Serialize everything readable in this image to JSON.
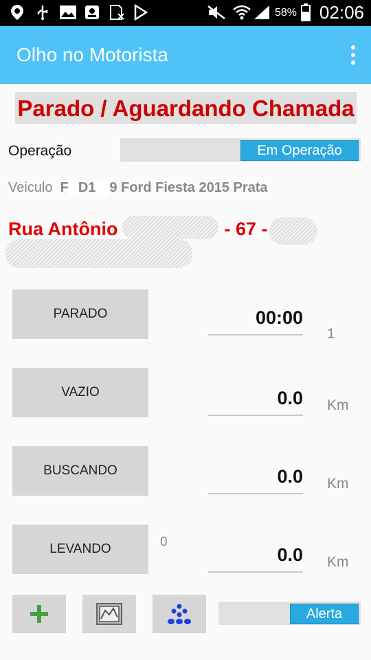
{
  "status_bar": {
    "battery": "58%",
    "time": "02:06",
    "icons": [
      "location-icon",
      "usb-icon",
      "gallery-icon",
      "notification-app-icon",
      "sim-icon",
      "play-store-icon",
      "mute-icon",
      "wifi-icon",
      "signal-icon",
      "battery-icon"
    ]
  },
  "app_bar": {
    "title": "Olho no Motorista",
    "menu_icon": "overflow-menu-icon"
  },
  "status_title": "Parado / Aguardando Chamada",
  "operation": {
    "label": "Operação",
    "toggle_text": "Em Operação"
  },
  "vehicle": {
    "label": "Veiculo",
    "plate_parts": [
      "F",
      "D1",
      "9"
    ],
    "model": "Ford Fiesta 2015 Prata"
  },
  "address": {
    "street": "Rua Antônio",
    "number": "- 67 -"
  },
  "rows": [
    {
      "button": "PARADO",
      "value": "00:00",
      "unit": "1"
    },
    {
      "button": "VAZIO",
      "value": "0.0",
      "unit": "Km"
    },
    {
      "button": "BUSCANDO",
      "value": "0.0",
      "unit": "Km"
    },
    {
      "button": "LEVANDO",
      "value": "0.0",
      "unit": "Km",
      "count": "0"
    }
  ],
  "bottom": {
    "icons": [
      "plus-icon",
      "map-icon",
      "people-icon"
    ],
    "alert_toggle": "Alerta"
  },
  "colors": {
    "appbar": "#4fc3f7",
    "accent": "#29a9e0",
    "status_red": "#cc0000"
  }
}
